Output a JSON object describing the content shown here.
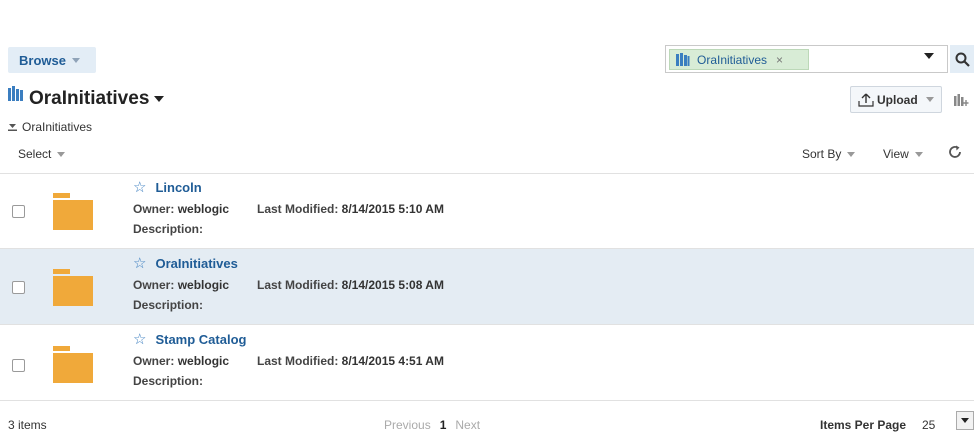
{
  "header": {
    "browse_label": "Browse",
    "search_chip": "OraInitiatives",
    "search_chip_remove": "×"
  },
  "title": {
    "text": "OraInitiatives",
    "upload_label": "Upload"
  },
  "breadcrumb": {
    "label": "OraInitiatives"
  },
  "toolbar": {
    "select_label": "Select",
    "sort_label": "Sort By",
    "view_label": "View"
  },
  "labels": {
    "owner": "Owner:",
    "last_modified": "Last Modified:",
    "description": "Description:"
  },
  "items": [
    {
      "name": "Lincoln",
      "owner": "weblogic",
      "modified": "8/14/2015 5:10 AM",
      "description": ""
    },
    {
      "name": "OraInitiatives",
      "owner": "weblogic",
      "modified": "8/14/2015 5:08 AM",
      "description": ""
    },
    {
      "name": "Stamp Catalog",
      "owner": "weblogic",
      "modified": "8/14/2015 4:51 AM",
      "description": ""
    }
  ],
  "footer": {
    "count": "3 items",
    "previous": "Previous",
    "page": "1",
    "next": "Next",
    "items_per_page_label": "Items Per Page",
    "items_per_page_value": "25"
  },
  "colors": {
    "accent": "#1f5c96",
    "folder": "#f0a93a",
    "selected_row": "#e4ecf3",
    "chip": "#d8ecd6"
  }
}
